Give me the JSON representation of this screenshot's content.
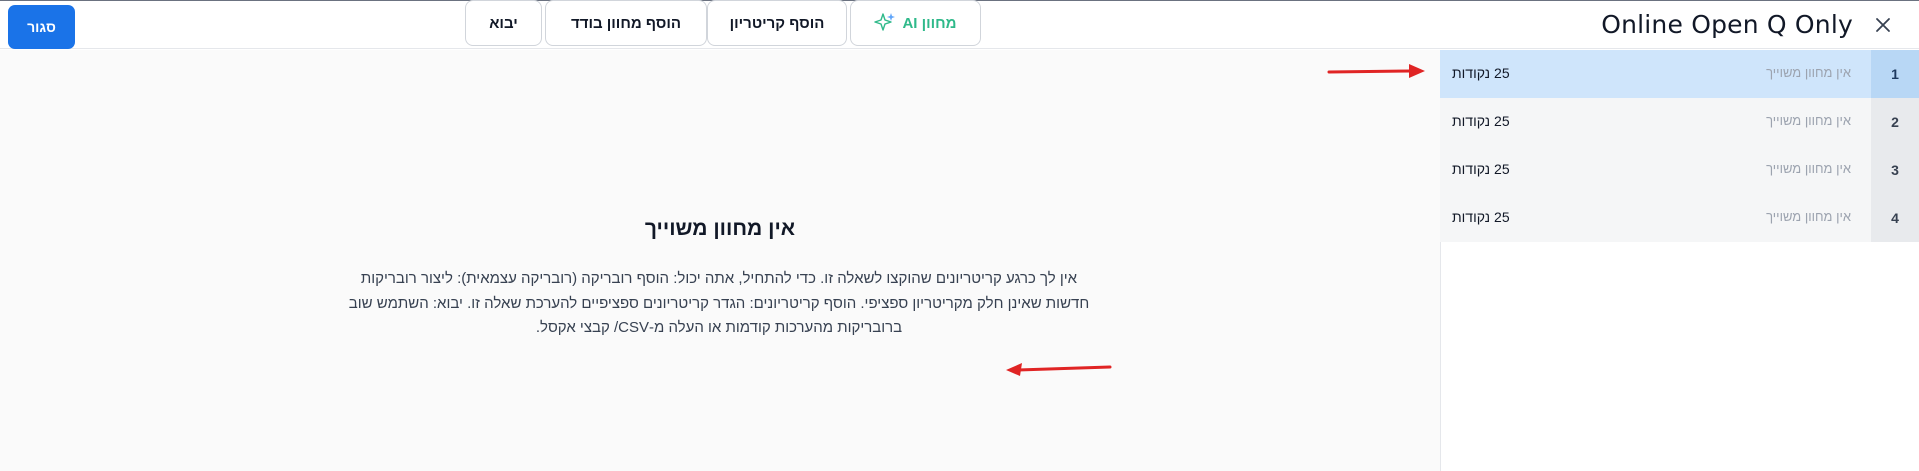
{
  "header": {
    "title": "Online Open Q Only",
    "close_button_label": "סגור",
    "close_icon": "close-icon"
  },
  "sidebar": {
    "items": [
      {
        "number": "1",
        "rubric": "אין מחוון משוייך",
        "points": "25 נקודות",
        "selected": true
      },
      {
        "number": "2",
        "rubric": "אין מחוון משוייך",
        "points": "25 נקודות",
        "selected": false
      },
      {
        "number": "3",
        "rubric": "אין מחוון משוייך",
        "points": "25 נקודות",
        "selected": false
      },
      {
        "number": "4",
        "rubric": "אין מחוון משוייך",
        "points": "25 נקודות",
        "selected": false
      }
    ]
  },
  "empty_state": {
    "title": "אין מחוון משוייך",
    "description": "אין לך כרגע קריטריונים שהוקצו לשאלה זו. כדי להתחיל, אתה יכול: הוסף רובריקה (רובריקה עצמאית): ליצור רובריקות חדשות שאינן חלק מקריטריון ספציפי. הוסף קריטריונים: הגדר קריטריונים ספציפיים להערכת שאלה זו. יבוא: השתמש שוב ברובריקות מהערכות קודמות או העלה מ-CSV/ קבצי אקסל."
  },
  "actions": {
    "ai_rubric_label": "מחוון AI",
    "ai_icon": "sparkles-icon",
    "add_criterion_label": "הוסף קריטריון",
    "add_single_rubric_label": "הוסף מחוון בודד",
    "import_label": "יבוא"
  },
  "colors": {
    "primary": "#1a73e8",
    "selected_row": "#cfe5fb",
    "ai_accent": "#2fb98a",
    "annotation_arrow": "#e02424"
  }
}
